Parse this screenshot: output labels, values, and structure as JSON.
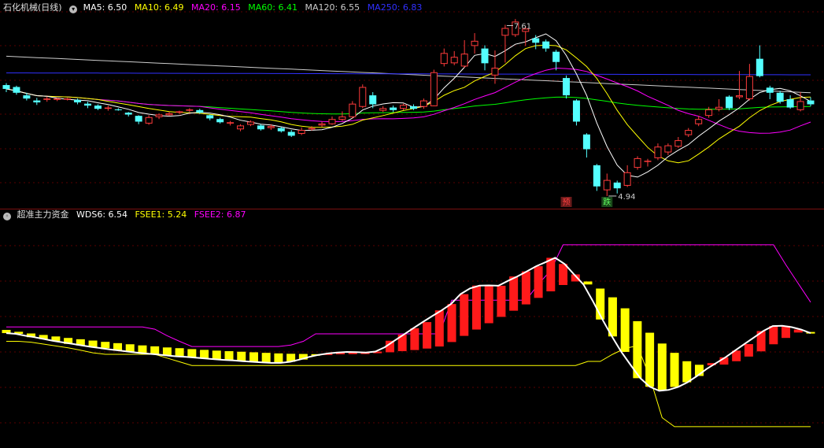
{
  "upper_panel": {
    "stock_name": "石化机械(日线)",
    "indicators": [
      {
        "label": "MA5: 6.50",
        "color": "#ffffff"
      },
      {
        "label": "MA10: 6.49",
        "color": "#ffff00"
      },
      {
        "label": "MA20: 6.15",
        "color": "#ff00ff"
      },
      {
        "label": "MA60: 6.41",
        "color": "#00ff00"
      },
      {
        "label": "MA120: 6.55",
        "color": "#cccccc"
      },
      {
        "label": "MA250: 6.83",
        "color": "#3030ff"
      }
    ],
    "high_marker": "7.61",
    "low_marker": "4.94",
    "badges": [
      {
        "text": "预",
        "color": "#ff4040",
        "bg": "#6a1a1a"
      },
      {
        "text": "跌",
        "color": "#60ff60",
        "bg": "#1a4a1a"
      }
    ]
  },
  "lower_panel": {
    "indicator_name": "超准主力资金",
    "values": [
      {
        "label": "WDS6: 6.54",
        "color": "#ffffff"
      },
      {
        "label": "FSEE1: 5.24",
        "color": "#ffff00"
      },
      {
        "label": "FSEE2: 6.87",
        "color": "#ff00ff"
      }
    ]
  },
  "chart_data": [
    {
      "type": "candlestick",
      "title": "石化机械(日线)",
      "ohlc": [
        [
          6.67,
          6.61,
          6.7,
          6.56
        ],
        [
          6.64,
          6.55,
          6.66,
          6.52
        ],
        [
          6.51,
          6.46,
          6.55,
          6.43
        ],
        [
          6.43,
          6.4,
          6.47,
          6.36
        ],
        [
          6.44,
          6.46,
          6.49,
          6.41
        ],
        [
          6.44,
          6.46,
          6.47,
          6.42
        ],
        [
          6.45,
          6.46,
          6.47,
          6.43
        ],
        [
          6.44,
          6.4,
          6.46,
          6.37
        ],
        [
          6.38,
          6.35,
          6.41,
          6.31
        ],
        [
          6.35,
          6.3,
          6.37,
          6.28
        ],
        [
          6.3,
          6.32,
          6.35,
          6.27
        ],
        [
          6.29,
          6.28,
          6.31,
          6.27
        ],
        [
          6.24,
          6.21,
          6.25,
          6.18
        ],
        [
          6.19,
          6.1,
          6.2,
          6.06
        ],
        [
          6.07,
          6.17,
          6.2,
          6.05
        ],
        [
          6.17,
          6.21,
          6.23,
          6.14
        ],
        [
          6.2,
          6.23,
          6.25,
          6.19
        ],
        [
          6.24,
          6.26,
          6.27,
          6.22
        ],
        [
          6.27,
          6.29,
          6.31,
          6.25
        ],
        [
          6.28,
          6.24,
          6.3,
          6.22
        ],
        [
          6.2,
          6.15,
          6.21,
          6.12
        ],
        [
          6.14,
          6.09,
          6.16,
          6.07
        ],
        [
          6.07,
          6.09,
          6.11,
          6.04
        ],
        [
          5.98,
          6.04,
          6.06,
          5.95
        ],
        [
          6.05,
          6.1,
          6.12,
          6.03
        ],
        [
          6.04,
          5.98,
          6.06,
          5.96
        ],
        [
          6.0,
          6.03,
          6.06,
          5.97
        ],
        [
          6.0,
          5.95,
          6.02,
          5.93
        ],
        [
          5.94,
          5.88,
          5.97,
          5.86
        ],
        [
          5.91,
          5.97,
          6.01,
          5.89
        ],
        [
          5.98,
          6.0,
          6.03,
          5.96
        ],
        [
          6.04,
          6.07,
          6.1,
          6.02
        ],
        [
          6.06,
          6.14,
          6.18,
          6.05
        ],
        [
          6.13,
          6.18,
          6.26,
          6.11
        ],
        [
          6.17,
          6.38,
          6.42,
          6.15
        ],
        [
          6.33,
          6.64,
          6.68,
          6.31
        ],
        [
          6.51,
          6.37,
          6.56,
          6.31
        ],
        [
          6.27,
          6.31,
          6.34,
          6.25
        ],
        [
          6.32,
          6.28,
          6.35,
          6.25
        ],
        [
          6.3,
          6.36,
          6.38,
          6.28
        ],
        [
          6.34,
          6.3,
          6.37,
          6.28
        ],
        [
          6.33,
          6.43,
          6.46,
          6.3
        ],
        [
          6.34,
          6.87,
          6.91,
          6.34
        ],
        [
          7.0,
          7.17,
          7.24,
          6.96
        ],
        [
          7.01,
          7.11,
          7.2,
          6.98
        ],
        [
          6.96,
          7.16,
          7.37,
          6.94
        ],
        [
          7.28,
          7.36,
          7.48,
          7.16
        ],
        [
          7.24,
          7.01,
          7.29,
          6.9
        ],
        [
          6.82,
          6.94,
          7.21,
          6.69
        ],
        [
          7.44,
          7.56,
          7.61,
          7.02
        ],
        [
          7.45,
          7.66,
          7.7,
          7.42
        ],
        [
          7.5,
          7.55,
          7.59,
          7.28
        ],
        [
          7.4,
          7.33,
          7.45,
          7.23
        ],
        [
          7.35,
          7.24,
          7.38,
          7.19
        ],
        [
          7.19,
          7.03,
          7.22,
          6.9
        ],
        [
          6.78,
          6.51,
          6.82,
          6.46
        ],
        [
          6.43,
          6.1,
          6.45,
          6.04
        ],
        [
          5.9,
          5.67,
          5.92,
          5.54
        ],
        [
          5.42,
          5.09,
          5.44,
          5.02
        ],
        [
          5.03,
          5.19,
          5.29,
          4.94
        ],
        [
          5.15,
          5.06,
          5.18,
          4.98
        ],
        [
          5.1,
          5.31,
          5.42,
          5.08
        ],
        [
          5.38,
          5.53,
          5.56,
          5.35
        ],
        [
          5.49,
          5.49,
          5.52,
          5.4
        ],
        [
          5.53,
          5.71,
          5.76,
          5.5
        ],
        [
          5.62,
          5.73,
          5.76,
          5.58
        ],
        [
          5.71,
          5.81,
          5.86,
          5.69
        ],
        [
          5.89,
          5.97,
          6.0,
          5.86
        ],
        [
          6.06,
          6.14,
          6.19,
          6.03
        ],
        [
          6.19,
          6.29,
          6.33,
          6.16
        ],
        [
          6.29,
          6.33,
          6.45,
          6.26
        ],
        [
          6.49,
          6.31,
          6.51,
          6.28
        ],
        [
          6.48,
          6.51,
          6.89,
          6.45
        ],
        [
          6.45,
          6.81,
          7.0,
          6.43
        ],
        [
          7.08,
          6.81,
          7.29,
          6.79
        ],
        [
          6.63,
          6.55,
          6.66,
          6.45
        ],
        [
          6.55,
          6.41,
          6.58,
          6.38
        ],
        [
          6.45,
          6.32,
          6.51,
          6.3
        ],
        [
          6.28,
          6.42,
          6.56,
          6.26
        ],
        [
          6.43,
          6.37,
          6.48,
          6.34
        ]
      ],
      "series": [
        {
          "name": "MA5",
          "last": 6.5
        },
        {
          "name": "MA10",
          "last": 6.49
        },
        {
          "name": "MA20",
          "last": 6.15
        },
        {
          "name": "MA60",
          "last": 6.41
        },
        {
          "name": "MA120",
          "last": 6.55
        },
        {
          "name": "MA250",
          "last": 6.83
        }
      ],
      "annotations": [
        {
          "text": "7.61",
          "bar": 49
        },
        {
          "text": "4.94",
          "bar": 59
        }
      ],
      "ylim": [
        4.78,
        7.8
      ],
      "grid": true
    },
    {
      "type": "bar+line",
      "title": "超准主力资金",
      "bar_values": [
        6.71,
        6.61,
        6.52,
        6.44,
        6.36,
        6.28,
        6.21,
        6.14,
        6.07,
        6.0,
        5.94,
        5.88,
        5.83,
        5.77,
        5.73,
        5.68,
        5.64,
        5.6,
        5.57,
        5.54,
        5.51,
        5.48,
        5.45,
        5.43,
        5.42,
        5.41,
        5.4,
        5.4,
        5.41,
        5.43,
        5.46,
        5.51,
        5.57,
        5.63,
        5.71,
        5.82,
        6.06,
        6.39,
        6.73,
        7.07,
        7.41,
        7.74,
        8.08,
        8.43,
        8.78,
        9.12,
        9.31,
        9.31,
        8.93,
        8.46,
        7.87,
        7.18,
        6.56,
        5.98,
        5.48,
        5.03,
        4.84,
        4.81,
        4.85,
        5.03,
        5.28,
        5.56,
        5.94,
        6.28,
        6.57,
        6.6
      ],
      "series": [
        {
          "name": "WDS6",
          "values": [
            6.54,
            6.5,
            6.4,
            6.32,
            6.22,
            6.12,
            6.04,
            5.96,
            5.88,
            5.8,
            5.73,
            5.66,
            5.6,
            5.54,
            5.48,
            5.43,
            5.39,
            5.34,
            5.29,
            5.26,
            5.22,
            5.18,
            5.14,
            5.1,
            5.07,
            5.03,
            5.0,
            4.97,
            4.94,
            4.94,
            5.0,
            5.12,
            5.26,
            5.37,
            5.45,
            5.5,
            5.53,
            5.52,
            5.5,
            5.55,
            5.78,
            6.13,
            6.46,
            6.8,
            7.13,
            7.45,
            7.76,
            8.1,
            8.63,
            8.94,
            9.09,
            9.1,
            9.08,
            9.34,
            9.58,
            9.85,
            10.13,
            10.35,
            10.58,
            10.25,
            9.69,
            9.15,
            8.24,
            7.27,
            6.36,
            5.53,
            4.81,
            4.12,
            3.66,
            3.44,
            3.49,
            3.65,
            3.9,
            4.24,
            4.61,
            4.93,
            5.24,
            5.6,
            5.95,
            6.3,
            6.65,
            6.92,
            6.93,
            6.86,
            6.73,
            6.54
          ]
        },
        {
          "name": "FSEE1",
          "values": [
            6.1,
            6.1,
            6.05,
            5.95,
            5.85,
            5.75,
            5.62,
            5.48,
            5.4,
            5.4,
            5.4,
            5.4,
            5.4,
            5.2,
            5.0,
            4.8,
            4.8,
            4.8,
            4.8,
            4.8,
            4.8,
            4.8,
            4.8,
            4.8,
            4.8,
            4.8,
            4.8,
            4.8,
            4.8,
            4.8,
            4.8,
            4.8,
            4.8,
            4.8,
            4.8,
            4.8,
            4.8,
            4.8,
            4.8,
            4.8,
            4.8,
            4.8,
            4.8,
            4.8,
            4.8,
            4.8,
            4.8,
            5.02,
            5.02,
            5.4,
            5.72,
            5.86,
            4.18,
            2.0,
            1.52,
            1.52,
            1.52,
            1.52,
            1.52,
            1.52,
            1.52,
            1.52,
            1.52,
            1.52,
            1.52,
            1.52
          ]
        },
        {
          "name": "FSEE2",
          "values": [
            6.87,
            6.87,
            6.87,
            6.87,
            6.87,
            6.87,
            6.87,
            6.87,
            6.87,
            6.87,
            6.87,
            6.87,
            6.75,
            6.4,
            6.1,
            5.82,
            5.82,
            5.82,
            5.82,
            5.82,
            5.82,
            5.82,
            5.82,
            5.9,
            6.1,
            6.5,
            6.5,
            6.5,
            6.5,
            6.5,
            6.5,
            6.5,
            6.5,
            6.5,
            6.5,
            6.5,
            8.31,
            8.31,
            8.31,
            8.31,
            8.31,
            8.31,
            8.31,
            9.16,
            9.91,
            11.28,
            11.28,
            11.28,
            11.28,
            11.28,
            11.28,
            11.28,
            11.28,
            11.28,
            11.28,
            11.28,
            11.28,
            11.28,
            11.28,
            11.28,
            11.28,
            11.28,
            11.28,
            10.2,
            9.2,
            8.2
          ]
        }
      ],
      "ylim": [
        0.5,
        12.5
      ],
      "grid": true
    }
  ]
}
